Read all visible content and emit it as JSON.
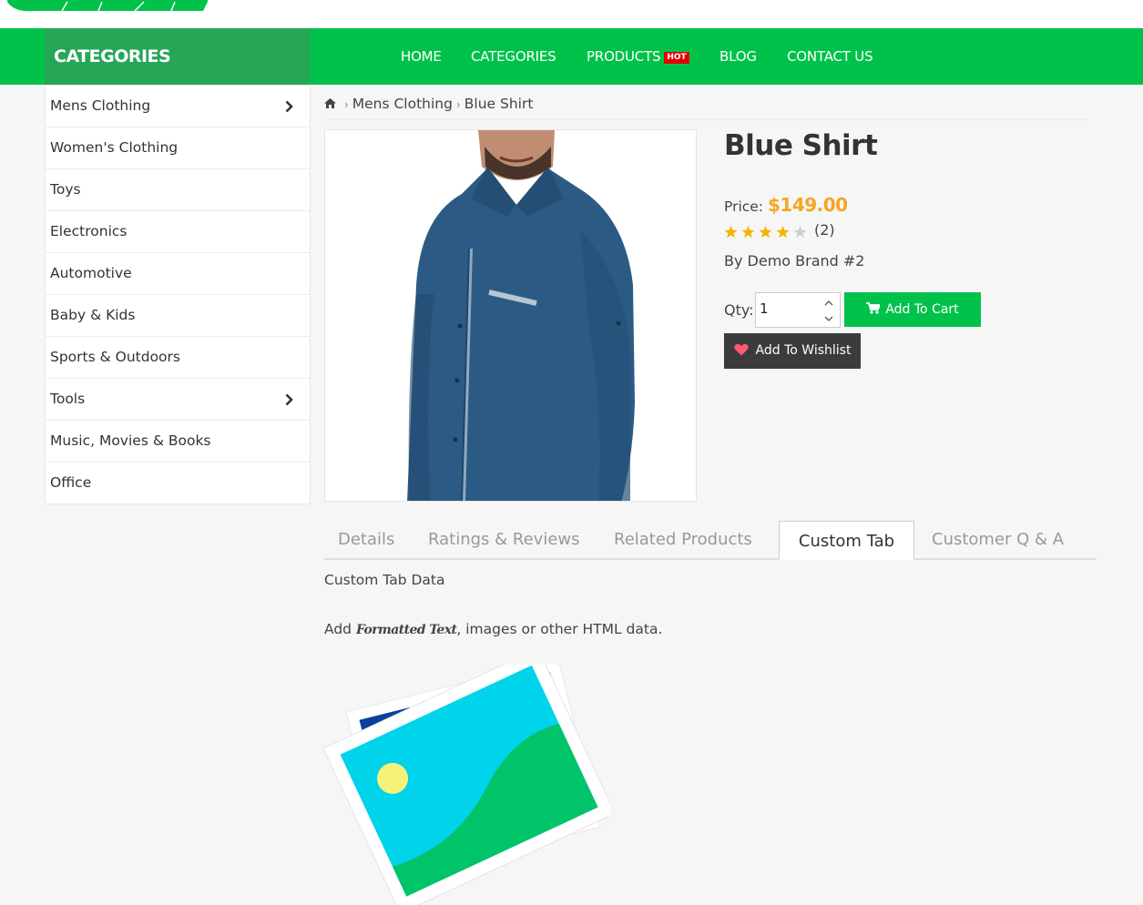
{
  "header": {
    "categories_title": "CATEGORIES",
    "menu": [
      {
        "label": "HOME"
      },
      {
        "label": "CATEGORIES"
      },
      {
        "label": "PRODUCTS",
        "badge": "HOT"
      },
      {
        "label": "BLOG"
      },
      {
        "label": "CONTACT US"
      }
    ],
    "nav_color": "#00c24a",
    "categories_color": "#26a657"
  },
  "sidebar": {
    "items": [
      {
        "label": "Mens Clothing",
        "has_submenu": true
      },
      {
        "label": "Women's Clothing",
        "has_submenu": false
      },
      {
        "label": "Toys",
        "has_submenu": false
      },
      {
        "label": "Electronics",
        "has_submenu": false
      },
      {
        "label": "Automotive",
        "has_submenu": false
      },
      {
        "label": "Baby & Kids",
        "has_submenu": false
      },
      {
        "label": "Sports & Outdoors",
        "has_submenu": false
      },
      {
        "label": "Tools",
        "has_submenu": true
      },
      {
        "label": "Music, Movies & Books",
        "has_submenu": false
      },
      {
        "label": "Office",
        "has_submenu": false
      }
    ]
  },
  "breadcrumb": {
    "home_icon": "home-icon",
    "items": [
      "Mens Clothing",
      "Blue Shirt"
    ],
    "separator": "›"
  },
  "product": {
    "title": "Blue Shirt",
    "price_label": "Price:",
    "price": "$149.00",
    "price_color": "#f5a623",
    "rating": 4,
    "rating_max": 5,
    "rating_count": "(2)",
    "brand": "By Demo Brand #2",
    "qty_label": "Qty:",
    "qty_value": "1",
    "add_to_cart": "Add To Cart",
    "add_to_wishlist": "Add To Wishlist"
  },
  "tabs": {
    "items": [
      "Details",
      "Ratings & Reviews",
      "Related Products",
      "Custom Tab",
      "Customer Q & A"
    ],
    "active": "Custom Tab"
  },
  "custom_tab": {
    "heading": "Custom Tab Data",
    "line_prefix": "Add ",
    "formatted": "Formatted Text",
    "line_suffix": ", images or other HTML data."
  }
}
